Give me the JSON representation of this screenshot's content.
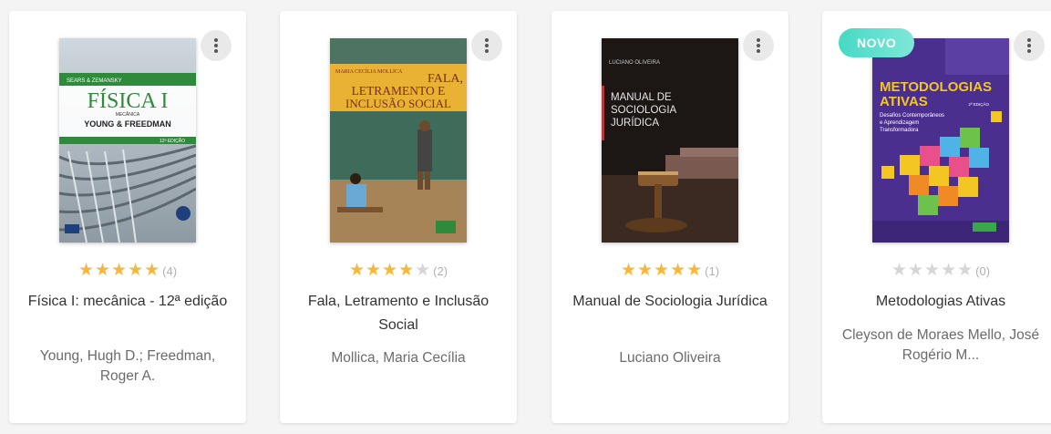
{
  "books": [
    {
      "title": "Física I: mecânica - 12ª edição",
      "author": "Young, Hugh D.; Freedman, Roger A.",
      "rating": 5,
      "rating_count": "(4)",
      "badge": "",
      "cover": {
        "top_label": "SEARS & ZEMANSKY",
        "main_title": "FÍSICA I",
        "subtitle": "MECÂNICA",
        "authors": "YOUNG & FREEDMAN",
        "edition": "12ª EDIÇÃO"
      }
    },
    {
      "title": "Fala, Letramento e Inclusão Social",
      "author": "Mollica, Maria Cecília",
      "rating": 4,
      "rating_count": "(2)",
      "badge": "",
      "cover": {
        "author_line": "MARIA CECÍLIA MOLLICA",
        "title_1": "FALA,",
        "title_2": "LETRAMENTO E",
        "title_3": "INCLUSÃO SOCIAL"
      }
    },
    {
      "title": "Manual de Sociologia Jurídica",
      "author": "Luciano Oliveira",
      "rating": 5,
      "rating_count": "(1)",
      "badge": "",
      "cover": {
        "author_line": "LUCIANO OLIVEIRA",
        "title_1": "MANUAL DE",
        "title_2": "SOCIOLOGIA",
        "title_3": "JURÍDICA"
      }
    },
    {
      "title": "Metodologias Ativas",
      "author": "Cleyson de Moraes Mello, José Rogério M...",
      "rating": 0,
      "rating_count": "(0)",
      "badge": "NOVO",
      "cover": {
        "title_1": "METODOLOGIAS",
        "title_2": "ATIVAS",
        "edition": "2ª EDIÇÃO",
        "sub_1": "Desafios Contemporâneos",
        "sub_2": "e Aprendizagem",
        "sub_3": "Transformadora"
      }
    }
  ],
  "icons": {
    "menu": "kebab-menu-icon",
    "star": "star-icon"
  },
  "colors": {
    "star_on": "#f6b73c",
    "star_off": "#d6d6d6",
    "badge": "#46d9c4"
  }
}
